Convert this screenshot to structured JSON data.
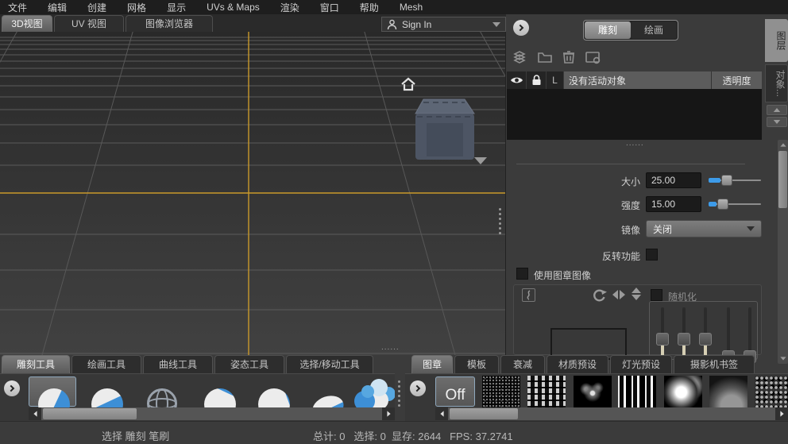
{
  "menu": {
    "items": [
      "文件",
      "编辑",
      "创建",
      "网格",
      "显示",
      "UVs & Maps",
      "渲染",
      "窗口",
      "帮助",
      "Mesh"
    ]
  },
  "view_tabs": {
    "t3d": "3D视图",
    "tuv": "UV 视图",
    "tbrowser": "图像浏览器"
  },
  "signin": {
    "label": "Sign In"
  },
  "right_panel": {
    "mode_sculpt": "雕刻",
    "mode_paint": "绘画",
    "layer_header": {
      "lock_col": "L",
      "name": "没有活动对象",
      "opacity": "透明度"
    },
    "drag_dots": "......",
    "size_label": "大小",
    "size_value": "25.00",
    "strength_label": "强度",
    "strength_value": "15.00",
    "mirror_label": "镜像",
    "mirror_value": "关闭",
    "invert_label": "反转功能",
    "use_stamp_label": "使用图章图像",
    "randomize_label": "随机化"
  },
  "side_tabs": {
    "layers": "图层",
    "objects": "对象..."
  },
  "left_tray": {
    "tabs": [
      "雕刻工具",
      "绘画工具",
      "曲线工具",
      "姿态工具",
      "选择/移动工具"
    ]
  },
  "right_tray": {
    "tabs": [
      "图章",
      "模板",
      "衰减",
      "材质预设",
      "灯光预设",
      "摄影机书签"
    ],
    "off_label": "Off",
    "stamp_names": [
      "off",
      "noise-speckle",
      "dot-grid",
      "splatter",
      "vertical-streaks",
      "cloud",
      "smoke-gradient",
      "rock-noise"
    ]
  },
  "status": {
    "brush_hint": "选择 雕刻 笔刷",
    "total_label": "总计:",
    "total_value": "0",
    "selected_label": "选择:",
    "selected_value": "0",
    "vram_label": "显存:",
    "vram_value": "2644",
    "fps_label": "FPS:",
    "fps_value": "37.2741"
  },
  "colors": {
    "accent_blue": "#3d9be9",
    "axis_yellow": "#c9992b",
    "selection_border": "#8fa8bd",
    "panel_bg": "#3b3b3b"
  },
  "icons": {
    "signin_person": "person-icon",
    "collapse": "circle-arrow-icon",
    "home": "home-icon",
    "layers": "layers-icon",
    "folder": "folder-icon",
    "trash": "trash-icon",
    "image": "image-icon",
    "eye": "eye-icon",
    "lock": "lock-icon",
    "rotate": "rotate-icon",
    "flip_h": "flip-horizontal-icon",
    "flip_v": "flip-vertical-icon"
  }
}
